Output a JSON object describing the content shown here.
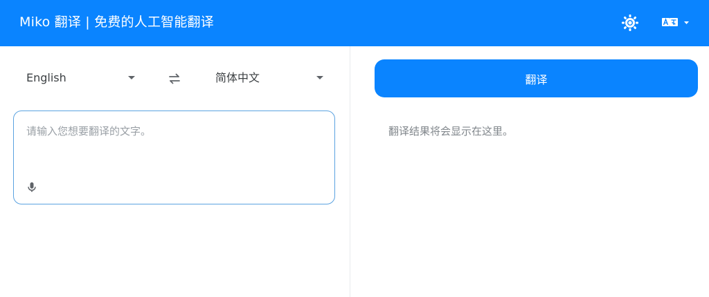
{
  "header": {
    "title": "Miko 翻译 | 免费的人工智能翻译",
    "theme_icon": "sun-icon",
    "language_icon": "translate-icon",
    "background_color": "#0a84ff"
  },
  "source_language": {
    "selected": "English",
    "icon": "chevron-down-icon"
  },
  "swap_icon": "swap-icon",
  "target_language": {
    "selected": "简体中文",
    "icon": "chevron-down-icon"
  },
  "input": {
    "placeholder": "请输入您想要翻译的文字。",
    "value": "",
    "mic_icon": "microphone-icon"
  },
  "translate_button": {
    "label": "翻译",
    "color": "#0a84ff"
  },
  "result": {
    "placeholder": "翻译结果将会显示在这里。"
  }
}
